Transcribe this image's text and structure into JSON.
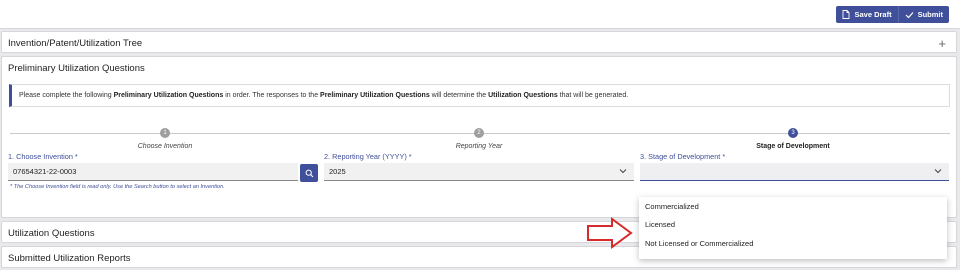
{
  "toolbar": {
    "save_draft_label": "Save Draft",
    "submit_label": "Submit"
  },
  "tree_panel": {
    "title": "Invention/Patent/Utilization Tree"
  },
  "prelim_panel": {
    "title": "Preliminary Utilization Questions",
    "info": {
      "p1": "Please complete the following ",
      "b1": "Preliminary Utilization Questions",
      "p2": " in order. The responses to the ",
      "b2": "Preliminary Utilization Questions",
      "p3": " will determine the ",
      "b3": "Utilization Questions",
      "p4": " that will be generated."
    },
    "steps": [
      {
        "number": "1",
        "label": "Choose Invention"
      },
      {
        "number": "2",
        "label": "Reporting Year"
      },
      {
        "number": "3",
        "label": "Stage of Development"
      }
    ],
    "fields": {
      "invention": {
        "label": "1. Choose Invention *",
        "value": "07654321-22-0003",
        "helper": "* The Choose Invention field is read only. Use the Search button to select an Invention."
      },
      "year": {
        "label": "2. Reporting Year (YYYY) *",
        "value": "2025"
      },
      "stage": {
        "label": "3. Stage of Development *",
        "value": ""
      }
    }
  },
  "stage_options": [
    "Commercialized",
    "Licensed",
    "Not Licensed or Commercialized"
  ],
  "utilization_panel": {
    "title": "Utilization Questions"
  },
  "submitted_panel": {
    "title": "Submitted Utilization Reports"
  },
  "colors": {
    "accent": "#3f4f9a",
    "annotation_arrow": "#d62b2b"
  }
}
